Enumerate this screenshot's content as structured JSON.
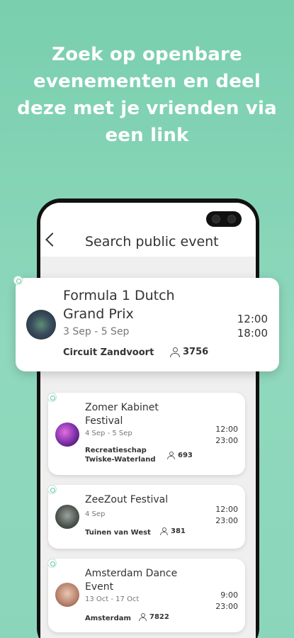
{
  "headline": [
    "Zoek op openbare",
    "evenementen en deel",
    "deze met je vrienden via",
    "een link"
  ],
  "appbar": {
    "title": "Search public event"
  },
  "icons": {
    "back": "chevron-left-icon",
    "attendees": "person-icon",
    "visibility": "globe-icon"
  },
  "colors": {
    "background": "#7fd1b3",
    "accent": "#62c79f",
    "card": "#ffffff",
    "text": "#333333"
  },
  "events": [
    {
      "title": "Formula 1 Dutch Grand Prix",
      "date": "3 Sep - 5 Sep",
      "location": "Circuit Zandvoort",
      "attendees": "3756",
      "start": "12:00",
      "end": "18:00"
    },
    {
      "title": "Zomer Kabinet Festival",
      "date": "4 Sep - 5 Sep",
      "location": "Recreatieschap Twiske-Waterland",
      "attendees": "693",
      "start": "12:00",
      "end": "23:00"
    },
    {
      "title": "ZeeZout Festival",
      "date": "4 Sep",
      "location": "Tuinen van West",
      "attendees": "381",
      "start": "12:00",
      "end": "23:00"
    },
    {
      "title": "Amsterdam Dance Event",
      "date": "13 Oct - 17 Oct",
      "location": "Amsterdam",
      "attendees": "7822",
      "start": "9:00",
      "end": "23:00"
    }
  ]
}
